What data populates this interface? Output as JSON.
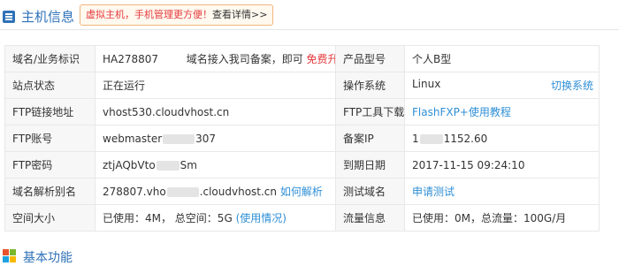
{
  "header": {
    "title": "主机信息",
    "notice_tip": "虚拟主机，手机管理更方便！",
    "notice_link": "查看详情>>"
  },
  "info": {
    "domain_label": "域名/业务标识",
    "domain_value": "HA278807",
    "domain_note": "域名接入我司备案，即可",
    "domain_upgrade": "免费升级",
    "product_label": "产品型号",
    "product_value": "个人B型",
    "status_label": "站点状态",
    "status_value": "正在运行",
    "os_label": "操作系统",
    "os_value": "Linux",
    "os_switch": "切换系统",
    "ftp_addr_label": "FTP链接地址",
    "ftp_addr_value": "vhost530.cloudvhost.cn",
    "ftp_tool_label": "FTP工具下载",
    "ftp_tool_value": "FlashFXP+使用教程",
    "ftp_user_label": "FTP账号",
    "ftp_user_prefix": "webmaster",
    "ftp_user_suffix": "307",
    "beian_ip_label": "备案IP",
    "beian_ip_prefix": "1",
    "beian_ip_mid": "1",
    "beian_ip_suffix": "152.60",
    "ftp_pass_label": "FTP密码",
    "ftp_pass_prefix": "ztjAQbVto",
    "ftp_pass_suffix": "Sm",
    "expire_label": "到期日期",
    "expire_value": "2017-11-15 09:24:10",
    "alias_label": "域名解析别名",
    "alias_prefix": "278807.vho",
    "alias_suffix": ".cloudvhost.cn",
    "alias_help": "如何解析",
    "test_domain_label": "测试域名",
    "test_domain_value": "申请测试",
    "space_label": "空间大小",
    "space_value": "已使用：4M， 总空间：5G",
    "space_usage": "(使用情况)",
    "traffic_label": "流量信息",
    "traffic_value": "已使用：0M，总流量：100G/月"
  },
  "section2": {
    "title": "基本功能"
  },
  "colors": {
    "accent": "#2f71b8",
    "link": "#2f8fd6",
    "alert": "#e4393c"
  }
}
